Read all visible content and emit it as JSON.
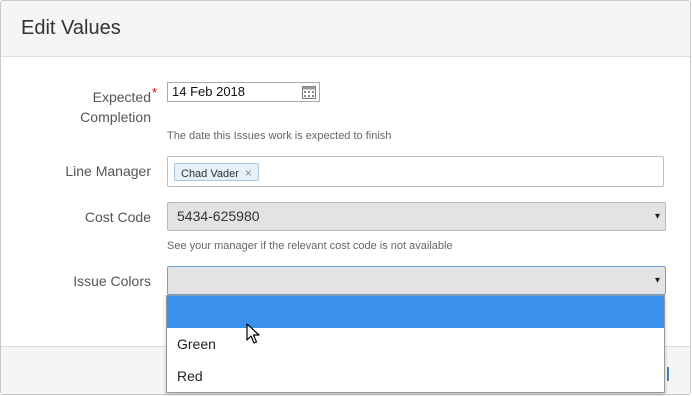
{
  "dialog": {
    "title": "Edit Values"
  },
  "fields": {
    "expected_completion": {
      "label_line1": "Expected",
      "label_line2": "Completion",
      "required_mark": "*",
      "value": "14 Feb 2018",
      "help": "The date this Issues work is expected to finish"
    },
    "line_manager": {
      "label": "Line Manager",
      "tags": [
        "Chad Vader"
      ],
      "remove_glyph": "×"
    },
    "cost_code": {
      "label": "Cost Code",
      "value": "5434-625980",
      "help": "See your manager if the relevant cost code is not available"
    },
    "issue_colors": {
      "label": "Issue Colors",
      "value": "",
      "options": [
        "",
        "Green",
        "Red"
      ],
      "highlighted_index": 0
    }
  },
  "icons": {
    "calendar": "calendar-icon",
    "dropdown_arrow": "▾"
  },
  "colors": {
    "highlight": "#3b92ee",
    "required": "#cc0000",
    "tag_bg": "#e6f0f9"
  }
}
